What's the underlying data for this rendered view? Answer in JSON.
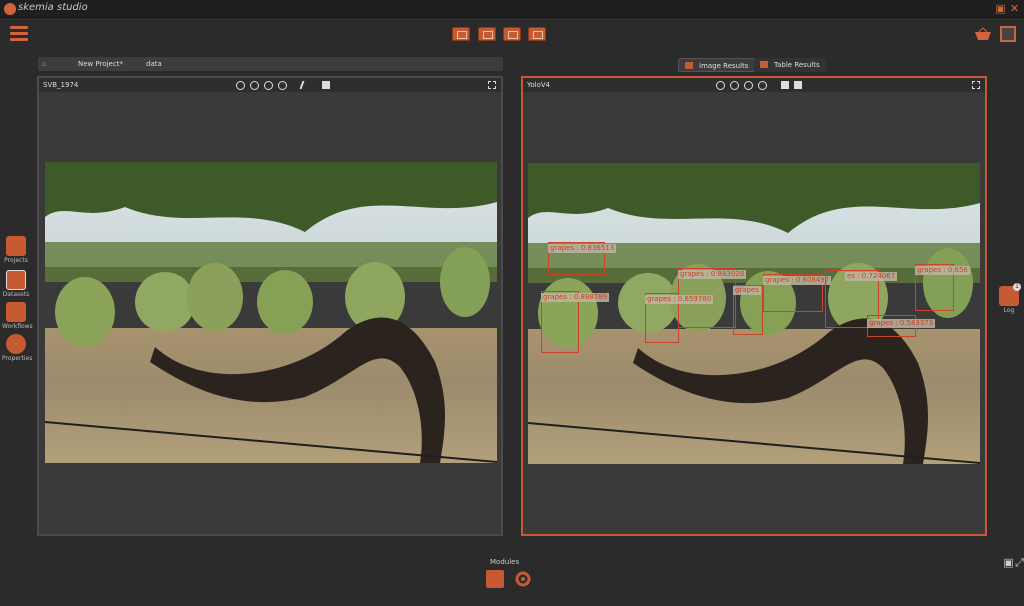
{
  "app": {
    "title": "skemia studio"
  },
  "breadcrumb": {
    "project": "New Project*",
    "folder": "data"
  },
  "left_panel": {
    "title": "SVB_1974"
  },
  "right_panel": {
    "title": "YoloV4"
  },
  "tabs": [
    {
      "label": "Image Results"
    },
    {
      "label": "Table Results"
    }
  ],
  "sidebar": {
    "items": [
      {
        "label": "Projects"
      },
      {
        "label": "Datasets"
      },
      {
        "label": "Workflows"
      },
      {
        "label": "Properties"
      }
    ]
  },
  "right_side": {
    "log_label": "Log",
    "log_badge": "1"
  },
  "footer": {
    "modules_label": "Modules"
  },
  "detections": [
    {
      "label": "grapes : 0.836513"
    },
    {
      "label": "grapes : 0.883028"
    },
    {
      "label": "grapes : 0.888789"
    },
    {
      "label": "grapes : 0.859780"
    },
    {
      "label": "grapes"
    },
    {
      "label": "grapes : 0.808497"
    },
    {
      "label": "es : 0.724067"
    },
    {
      "label": "grapes : 0.656"
    },
    {
      "label": "grapes : 0.583373"
    }
  ],
  "colors": {
    "accent": "#c65a32",
    "box": "#c9452a"
  }
}
